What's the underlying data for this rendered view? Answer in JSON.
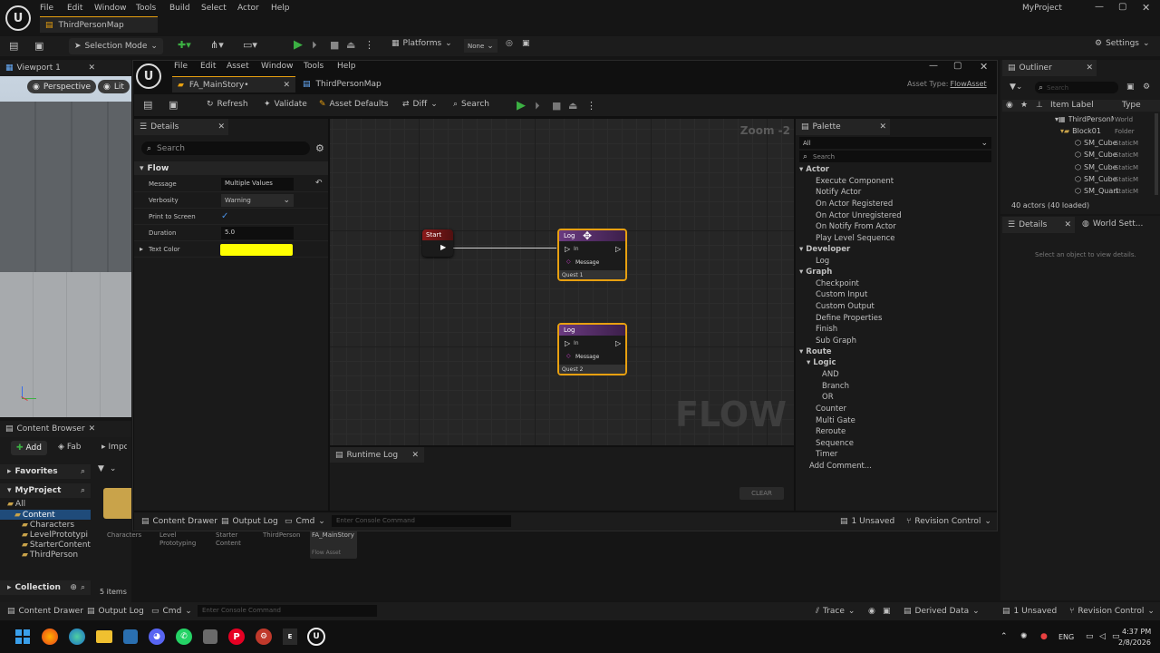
{
  "main_menu": [
    "File",
    "Edit",
    "Window",
    "Tools",
    "Build",
    "Select",
    "Actor",
    "Help"
  ],
  "project_name": "MyProject",
  "map_tab": "ThirdPersonMap",
  "main_toolbar": {
    "selection_mode": "Selection Mode",
    "platforms": "Platforms",
    "none_label": "None",
    "settings": "Settings"
  },
  "viewport": {
    "tab": "Viewport 1",
    "perspective": "Perspective",
    "lit": "Lit"
  },
  "content_browser": {
    "tab": "Content Browser",
    "add": "Add",
    "fab": "Fab",
    "import": "Impo",
    "favorites": "Favorites",
    "myproject": "MyProject",
    "tree": [
      "All",
      "Content",
      "Characters",
      "LevelPrototypi",
      "StarterContent",
      "ThirdPerson"
    ],
    "collection": "Collection",
    "items_count": "5 items",
    "assets": [
      {
        "name": "Characters"
      },
      {
        "name": "Level\nPrototyping"
      },
      {
        "name": "Starter\nContent"
      },
      {
        "name": "ThirdPerson"
      },
      {
        "name": "FA_MainStory",
        "sub": "Flow Asset"
      }
    ]
  },
  "flow_editor": {
    "menu": [
      "File",
      "Edit",
      "Asset",
      "Window",
      "Tools",
      "Help"
    ],
    "tabs": [
      {
        "label": "FA_MainStory•"
      },
      {
        "label": "ThirdPersonMap"
      }
    ],
    "asset_type_label": "Asset Type:",
    "asset_type_value": "FlowAsset",
    "toolbar": {
      "refresh": "Refresh",
      "validate": "Validate",
      "asset_defaults": "Asset Defaults",
      "diff": "Diff",
      "search": "Search"
    },
    "details": {
      "tab": "Details",
      "search_placeholder": "Search",
      "section": "Flow",
      "props": [
        {
          "label": "Message",
          "value": "Multiple Values"
        },
        {
          "label": "Verbosity",
          "value": "Warning"
        },
        {
          "label": "Print to Screen",
          "value": "✓"
        },
        {
          "label": "Duration",
          "value": "5.0"
        },
        {
          "label": "Text Color",
          "value": ""
        }
      ],
      "text_color": "#ffff00"
    },
    "graph": {
      "zoom": "Zoom -2",
      "watermark": "FLOW",
      "start_node": {
        "title": "Start"
      },
      "log_nodes": [
        {
          "title": "Log",
          "pin_in": "In",
          "pin_message": "Message",
          "footer": "Quest 1"
        },
        {
          "title": "Log",
          "pin_in": "In",
          "pin_message": "Message",
          "footer": "Quest 2"
        }
      ]
    },
    "palette": {
      "tab": "Palette",
      "filter": "All",
      "search_placeholder": "Search",
      "groups": [
        {
          "name": "Actor",
          "items": [
            "Execute Component",
            "Notify Actor",
            "On Actor Registered",
            "On Actor Unregistered",
            "On Notify From Actor",
            "Play Level Sequence"
          ]
        },
        {
          "name": "Developer",
          "items": [
            "Log"
          ]
        },
        {
          "name": "Graph",
          "items": [
            "Checkpoint",
            "Custom Input",
            "Custom Output",
            "Define Properties",
            "Finish",
            "Sub Graph"
          ]
        },
        {
          "name": "Route",
          "subgroup": "Logic",
          "sub_items": [
            "AND",
            "Branch",
            "OR"
          ],
          "items": [
            "Counter",
            "Multi Gate",
            "Reroute",
            "Sequence",
            "Timer"
          ]
        }
      ],
      "add_comment": "Add Comment..."
    },
    "runtime_log": {
      "tab": "Runtime Log",
      "clear": "CLEAR"
    },
    "bottom": {
      "content_drawer": "Content Drawer",
      "output_log": "Output Log",
      "cmd": "Cmd",
      "console_placeholder": "Enter Console Command",
      "unsaved": "1 Unsaved",
      "revision": "Revision Control"
    }
  },
  "outliner": {
    "tab": "Outliner",
    "search_placeholder": "Search",
    "col_label": "Item Label",
    "col_type": "Type",
    "rows": [
      {
        "label": "ThirdPersonM",
        "type": "World"
      },
      {
        "label": "Block01",
        "type": "Folder"
      },
      {
        "label": "SM_Cube",
        "type": "StaticM"
      },
      {
        "label": "SM_Cube",
        "type": "StaticM"
      },
      {
        "label": "SM_Cube",
        "type": "StaticM"
      },
      {
        "label": "SM_Cube",
        "type": "StaticM"
      },
      {
        "label": "SM_Quart",
        "type": "StaticM"
      }
    ],
    "actors": "40 actors (40 loaded)"
  },
  "right_details": {
    "tab": "Details",
    "world_settings": "World Sett...",
    "empty": "Select an object to view details."
  },
  "statusbar": {
    "content_drawer": "Content Drawer",
    "output_log": "Output Log",
    "cmd": "Cmd",
    "console_placeholder": "Enter Console Command",
    "trace": "Trace",
    "derived": "Derived Data",
    "unsaved": "1 Unsaved",
    "revision": "Revision Control"
  },
  "taskbar": {
    "lang": "ENG",
    "time": "4:37 PM",
    "date": "2/8/2026"
  },
  "colors": {
    "accent": "#4a90e2",
    "play": "#3cb043",
    "node_selected": "#e8a010",
    "log_header": "#5a2a6a"
  }
}
